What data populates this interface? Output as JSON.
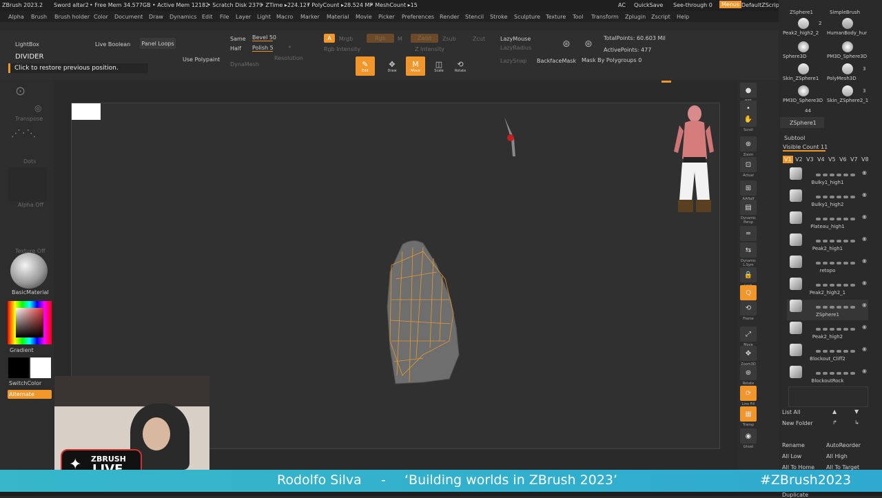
{
  "titlebar": {
    "app": "ZBrush 2023.2",
    "document": "Sword altar2",
    "free_mem": "• Free Mem 34.577GB",
    "active_mem": "• Active Mem 12182",
    "scratch": "• Scratch Disk 2379",
    "ztime": "• ZTime ▸224.127",
    "polycount": "• PolyCount ▸28.524 MP",
    "meshcount": "• MeshCount ▸15",
    "ac": "AC",
    "quicksave": "QuickSave",
    "seethrough": "See-through 0",
    "menus": "Menus",
    "script": "DefaultZScript"
  },
  "menubar": [
    "Alpha",
    "Brush",
    "Brush holder",
    "Color",
    "Document",
    "Draw",
    "Dynamics",
    "Edit",
    "File",
    "Layer",
    "Light",
    "Macro",
    "Marker",
    "Material",
    "Movie",
    "Picker",
    "Preferences",
    "Render",
    "Stencil",
    "Stroke",
    "Sculpture",
    "Texture",
    "Tool",
    "Transform",
    "Zplugin",
    "Zscript",
    "Help"
  ],
  "toolbar": {
    "lightbox": "LightBox",
    "divider": "DIVIDER",
    "tooltip": "Click to restore previous position.",
    "live_boolean": "Live Boolean",
    "panel_loops": "Panel Loops",
    "use_polypaint": "Use Polypaint",
    "same": "Same",
    "half": "Half",
    "bevel": "Bevel 50",
    "polish": "Polish 5",
    "dynamesh": "DynaMesh",
    "resolution": "Resolution",
    "a": "A",
    "mrgb": "Mrgb",
    "rgb": "Rgb",
    "m": "M",
    "zadd": "Zadd",
    "zsub": "Zsub",
    "zcut": "Zcut",
    "rgb_intensity": "Rgb Intensity",
    "z_intensity": "Z Intensity",
    "edit": "Edit",
    "draw": "Draw",
    "move": "Move",
    "scale": "Scale",
    "rotate": "Rotate",
    "lazymouse": "LazyMouse",
    "lazyradius": "LazyRadius",
    "lazysnap": "LazySnap",
    "backface": "BackfaceMask",
    "mask_poly": "Mask By Polygroups 0",
    "total_points": "TotalPoints: 60.603 Mil",
    "active_points": "ActivePoints: 477"
  },
  "leftshelf": {
    "transpose": "Transpose",
    "dots": "Dots",
    "alpha_off": "Alpha Off",
    "texture_off": "Texture Off",
    "material": "BasicMaterial",
    "gradient": "Gradient",
    "switchcolor": "SwitchColor",
    "alternate": "Alternate"
  },
  "rightshelf": [
    "BPR",
    "SPix 0",
    "Scroll",
    "Zoom",
    "Actual",
    "AAHalf",
    "Dynamic Persp",
    "Floor",
    "Dynamic L.Sym",
    "Lock",
    "Qxyz",
    "Frame",
    "Move",
    "Zoom3D",
    "Rotate",
    "Line Fill PolyF",
    "Transp",
    "Ghost"
  ],
  "tools": {
    "row1": [
      "Peak2_high2_2",
      "HumanBody_hur"
    ],
    "row2": [
      "Sphere3D",
      "PM3D_Sphere3D"
    ],
    "row3": [
      "Skin_ZSphere1",
      "PolyMesh3D"
    ],
    "row4": [
      "PM3D_Sphere3D",
      "Skin_ZSphere2_1"
    ],
    "top": [
      "ZSphere1",
      "SimpleBrush"
    ],
    "count_a": "2",
    "count_b": "3",
    "count_c": "3",
    "count_44": "44",
    "current": "ZSphere1"
  },
  "subtool": {
    "title": "Subtool",
    "visible": "Visible Count 11",
    "versions": [
      "V1",
      "V2",
      "V3",
      "V4",
      "V5",
      "V6",
      "V7",
      "V8"
    ],
    "items": [
      "Bulky1_high1",
      "Bulky1_high2",
      "Plateau_high1",
      "Peak2_high1",
      "retopo",
      "Peak2_high2_1",
      "ZSphere1",
      "Peak2_high2",
      "Blockout_Cliff2",
      "BlockoutRock"
    ],
    "list_all": "List All",
    "new_folder": "New Folder",
    "rename": "Rename",
    "autoreorder": "AutoReorder",
    "all_low": "All Low",
    "all_high": "All High",
    "all_to_home": "All To Home",
    "all_to_target": "All To Target",
    "duplicate": "Duplicate"
  },
  "banner": {
    "presenter": "Rodolfo Silva",
    "dash": "-",
    "talk": "‘Building worlds in ZBrush 2023’",
    "hashtag": "#ZBrush2023"
  },
  "logo": {
    "top": "ZBRUSH",
    "bottom": "LIVE"
  },
  "colors": {
    "accent": "#f0962a",
    "banner": "#37b7c9"
  }
}
